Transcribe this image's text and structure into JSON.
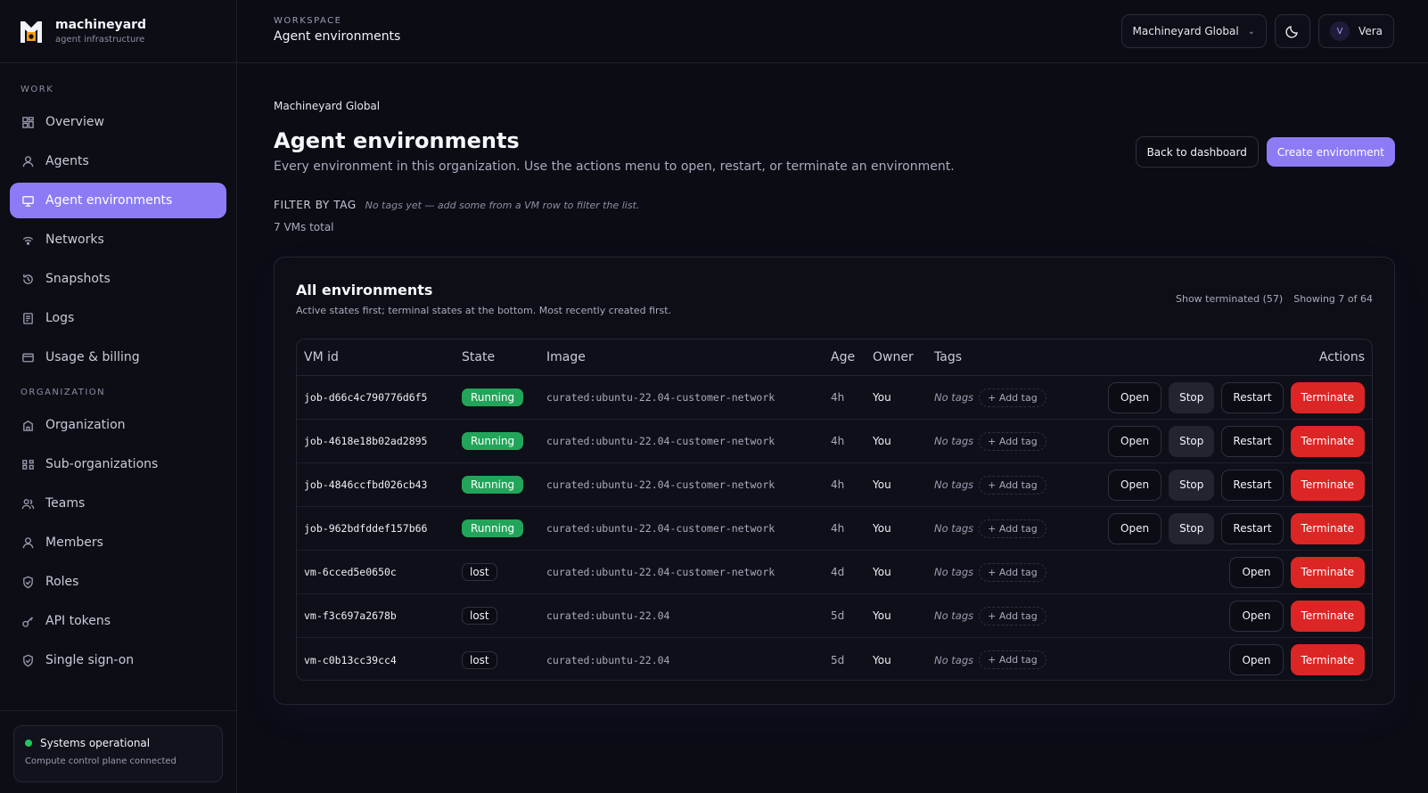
{
  "brand": {
    "name": "machineyard",
    "subtitle": "agent infrastructure",
    "logo_icon": "machineyard-logo"
  },
  "sidebar": {
    "work_heading": "WORK",
    "work_items": [
      {
        "label": "Overview",
        "icon": "grid-icon"
      },
      {
        "label": "Agents",
        "icon": "user-icon"
      },
      {
        "label": "Agent environments",
        "icon": "monitor-icon",
        "active": true
      },
      {
        "label": "Networks",
        "icon": "wifi-icon"
      },
      {
        "label": "Snapshots",
        "icon": "history-icon"
      },
      {
        "label": "Logs",
        "icon": "document-icon"
      },
      {
        "label": "Usage & billing",
        "icon": "card-icon"
      }
    ],
    "org_heading": "ORGANIZATION",
    "org_items": [
      {
        "label": "Organization",
        "icon": "building-icon"
      },
      {
        "label": "Sub-organizations",
        "icon": "hierarchy-icon"
      },
      {
        "label": "Teams",
        "icon": "users-icon"
      },
      {
        "label": "Members",
        "icon": "person-icon"
      },
      {
        "label": "Roles",
        "icon": "shield-check-icon"
      },
      {
        "label": "API tokens",
        "icon": "key-icon"
      },
      {
        "label": "Single sign-on",
        "icon": "shield-icon"
      }
    ],
    "status": {
      "title": "Systems operational",
      "subtitle": "Compute control plane connected",
      "color": "#22c55e"
    }
  },
  "header": {
    "eyebrow": "WORKSPACE",
    "title": "Agent environments",
    "org_select": "Machineyard Global",
    "theme_icon": "moon-icon",
    "user": {
      "initial": "V",
      "name": "Vera"
    }
  },
  "page": {
    "org_crumb": "Machineyard Global",
    "title": "Agent environments",
    "description": "Every environment in this organization. Use the actions menu to open, restart, or terminate an environment.",
    "back_label": "Back to dashboard",
    "create_label": "Create environment",
    "filter_label": "FILTER BY TAG",
    "filter_hint": "No tags yet — add some from a VM row to filter the list.",
    "vm_total": "7 VMs total"
  },
  "card": {
    "title": "All environments",
    "subtitle": "Active states first; terminal states at the bottom. Most recently created first.",
    "show_terminated": "Show terminated (57)",
    "showing": "Showing 7 of 64"
  },
  "table": {
    "columns": {
      "id": "VM id",
      "state": "State",
      "image": "Image",
      "age": "Age",
      "owner": "Owner",
      "tags": "Tags",
      "actions": "Actions"
    },
    "no_tags": "No tags",
    "add_tag": "+ Add tag",
    "actions": {
      "open": "Open",
      "stop": "Stop",
      "restart": "Restart",
      "terminate": "Terminate"
    },
    "rows": [
      {
        "id": "job-d66c4c790776d6f5",
        "state": "Running",
        "image": "curated:ubuntu-22.04-customer-network",
        "age": "4h",
        "owner": "You"
      },
      {
        "id": "job-4618e18b02ad2895",
        "state": "Running",
        "image": "curated:ubuntu-22.04-customer-network",
        "age": "4h",
        "owner": "You"
      },
      {
        "id": "job-4846ccfbd026cb43",
        "state": "Running",
        "image": "curated:ubuntu-22.04-customer-network",
        "age": "4h",
        "owner": "You"
      },
      {
        "id": "job-962bdfddef157b66",
        "state": "Running",
        "image": "curated:ubuntu-22.04-customer-network",
        "age": "4h",
        "owner": "You"
      },
      {
        "id": "vm-6cced5e0650c",
        "state": "lost",
        "image": "curated:ubuntu-22.04-customer-network",
        "age": "4d",
        "owner": "You"
      },
      {
        "id": "vm-f3c697a2678b",
        "state": "lost",
        "image": "curated:ubuntu-22.04",
        "age": "5d",
        "owner": "You"
      },
      {
        "id": "vm-c0b13cc39cc4",
        "state": "lost",
        "image": "curated:ubuntu-22.04",
        "age": "5d",
        "owner": "You"
      }
    ]
  },
  "colors": {
    "accent": "#8b7cf6",
    "running": "#22a55a",
    "danger": "#dc2626",
    "background": "#0b0c14"
  }
}
